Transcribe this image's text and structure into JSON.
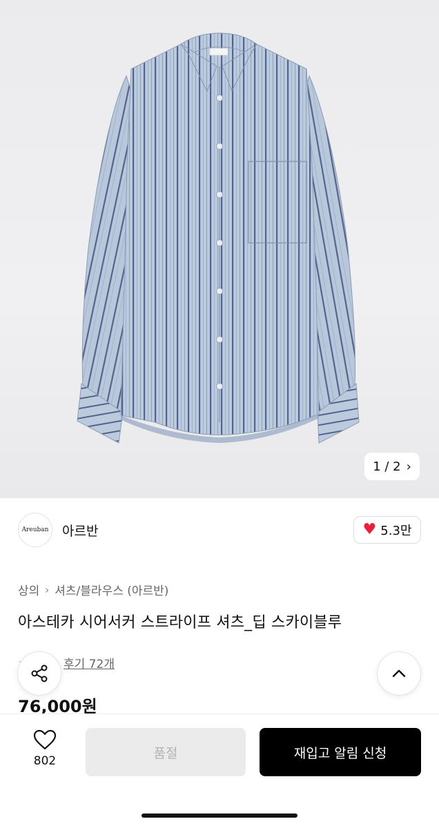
{
  "product_image": {
    "pager_text": "1 / 2",
    "label_text": "Areuban"
  },
  "brand": {
    "logo_text": "Areuban",
    "name": "아르반",
    "likes": "5.3만"
  },
  "breadcrumb": {
    "root": "상의",
    "separator": "›",
    "category": "셔츠/블라우스 (아르반)"
  },
  "product": {
    "title": "아스테카 시어서커 스트라이프 셔츠_딥 스카이블루",
    "rating_stars": "★★",
    "reviews": "후기 72개",
    "price": "76,000원"
  },
  "bottom_bar": {
    "wish_count": "802",
    "soldout_label": "품절",
    "restock_label": "재입고 알림 신청"
  },
  "icons": [
    "share-icon",
    "chevron-up-icon",
    "heart-outline-icon",
    "heart-filled-icon",
    "chevron-right-icon"
  ],
  "colors": {
    "accent_heart": "#e8203a",
    "primary_button": "#000000",
    "disabled_button": "#ebebeb",
    "shirt_base": "#b8c6dc",
    "shirt_stripe": "#4b5d80"
  }
}
